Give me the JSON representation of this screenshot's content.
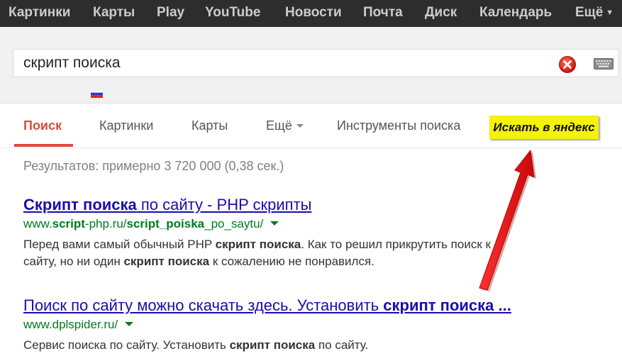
{
  "topbar": {
    "items": [
      "Картинки",
      "Карты",
      "Play",
      "YouTube",
      "Новости",
      "Почта",
      "Диск",
      "Календарь",
      "Ещё"
    ]
  },
  "search": {
    "query": "скрипт поиска",
    "clear_icon": "clear-icon",
    "keyboard_icon": "keyboard-icon",
    "flag_icon": "russia-flag-icon"
  },
  "tabs": {
    "items": [
      "Поиск",
      "Картинки",
      "Карты",
      "Ещё",
      "Инструменты поиска"
    ],
    "active_color": "#dd4b39"
  },
  "yandex_button": {
    "label": "Искать в яндекс",
    "color": "#f4f20e"
  },
  "stats": "Результатов: примерно 3 720 000 (0,38 сек.)",
  "results": [
    {
      "title_bold": "Скрипт поиска",
      "title_rest": " по сайту - PHP скрипты",
      "url_prefix": "www.",
      "url_bold1": "script",
      "url_mid": "-php.ru/",
      "url_bold2": "script_poiska",
      "url_rest": "_po_saytu/",
      "snippet_line1_a": "Перед вами самый обычный PHP ",
      "snippet_line1_b": "скрипт поиска",
      "snippet_line1_c": ". Как то решил прикрутить поиск к",
      "snippet_line2_a": "сайту, но ни один ",
      "snippet_line2_b": "скрипт поиска",
      "snippet_line2_c": " к сожалению не понравился."
    },
    {
      "title_rest": "Поиск по сайту можно скачать здесь. Установить ",
      "title_bold": "скрипт поиска ...",
      "url": "www.dplspider.ru/",
      "snippet_a": "Сервис поиска по сайту. Установить ",
      "snippet_b": "скрипт поиска",
      "snippet_c": " по сайту."
    }
  ],
  "colors": {
    "link": "#1a0dab",
    "url": "#007a1f",
    "annotation_arrow": "#ee1c1c"
  }
}
